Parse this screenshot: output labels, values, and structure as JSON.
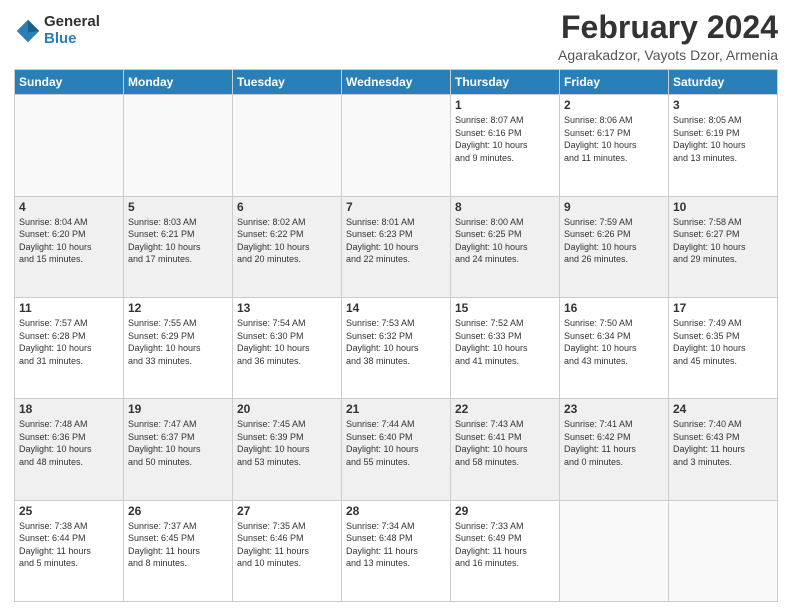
{
  "logo": {
    "general": "General",
    "blue": "Blue"
  },
  "header": {
    "title": "February 2024",
    "subtitle": "Agarakadzor, Vayots Dzor, Armenia"
  },
  "weekdays": [
    "Sunday",
    "Monday",
    "Tuesday",
    "Wednesday",
    "Thursday",
    "Friday",
    "Saturday"
  ],
  "weeks": [
    [
      {
        "day": "",
        "info": ""
      },
      {
        "day": "",
        "info": ""
      },
      {
        "day": "",
        "info": ""
      },
      {
        "day": "",
        "info": ""
      },
      {
        "day": "1",
        "info": "Sunrise: 8:07 AM\nSunset: 6:16 PM\nDaylight: 10 hours\nand 9 minutes."
      },
      {
        "day": "2",
        "info": "Sunrise: 8:06 AM\nSunset: 6:17 PM\nDaylight: 10 hours\nand 11 minutes."
      },
      {
        "day": "3",
        "info": "Sunrise: 8:05 AM\nSunset: 6:19 PM\nDaylight: 10 hours\nand 13 minutes."
      }
    ],
    [
      {
        "day": "4",
        "info": "Sunrise: 8:04 AM\nSunset: 6:20 PM\nDaylight: 10 hours\nand 15 minutes."
      },
      {
        "day": "5",
        "info": "Sunrise: 8:03 AM\nSunset: 6:21 PM\nDaylight: 10 hours\nand 17 minutes."
      },
      {
        "day": "6",
        "info": "Sunrise: 8:02 AM\nSunset: 6:22 PM\nDaylight: 10 hours\nand 20 minutes."
      },
      {
        "day": "7",
        "info": "Sunrise: 8:01 AM\nSunset: 6:23 PM\nDaylight: 10 hours\nand 22 minutes."
      },
      {
        "day": "8",
        "info": "Sunrise: 8:00 AM\nSunset: 6:25 PM\nDaylight: 10 hours\nand 24 minutes."
      },
      {
        "day": "9",
        "info": "Sunrise: 7:59 AM\nSunset: 6:26 PM\nDaylight: 10 hours\nand 26 minutes."
      },
      {
        "day": "10",
        "info": "Sunrise: 7:58 AM\nSunset: 6:27 PM\nDaylight: 10 hours\nand 29 minutes."
      }
    ],
    [
      {
        "day": "11",
        "info": "Sunrise: 7:57 AM\nSunset: 6:28 PM\nDaylight: 10 hours\nand 31 minutes."
      },
      {
        "day": "12",
        "info": "Sunrise: 7:55 AM\nSunset: 6:29 PM\nDaylight: 10 hours\nand 33 minutes."
      },
      {
        "day": "13",
        "info": "Sunrise: 7:54 AM\nSunset: 6:30 PM\nDaylight: 10 hours\nand 36 minutes."
      },
      {
        "day": "14",
        "info": "Sunrise: 7:53 AM\nSunset: 6:32 PM\nDaylight: 10 hours\nand 38 minutes."
      },
      {
        "day": "15",
        "info": "Sunrise: 7:52 AM\nSunset: 6:33 PM\nDaylight: 10 hours\nand 41 minutes."
      },
      {
        "day": "16",
        "info": "Sunrise: 7:50 AM\nSunset: 6:34 PM\nDaylight: 10 hours\nand 43 minutes."
      },
      {
        "day": "17",
        "info": "Sunrise: 7:49 AM\nSunset: 6:35 PM\nDaylight: 10 hours\nand 45 minutes."
      }
    ],
    [
      {
        "day": "18",
        "info": "Sunrise: 7:48 AM\nSunset: 6:36 PM\nDaylight: 10 hours\nand 48 minutes."
      },
      {
        "day": "19",
        "info": "Sunrise: 7:47 AM\nSunset: 6:37 PM\nDaylight: 10 hours\nand 50 minutes."
      },
      {
        "day": "20",
        "info": "Sunrise: 7:45 AM\nSunset: 6:39 PM\nDaylight: 10 hours\nand 53 minutes."
      },
      {
        "day": "21",
        "info": "Sunrise: 7:44 AM\nSunset: 6:40 PM\nDaylight: 10 hours\nand 55 minutes."
      },
      {
        "day": "22",
        "info": "Sunrise: 7:43 AM\nSunset: 6:41 PM\nDaylight: 10 hours\nand 58 minutes."
      },
      {
        "day": "23",
        "info": "Sunrise: 7:41 AM\nSunset: 6:42 PM\nDaylight: 11 hours\nand 0 minutes."
      },
      {
        "day": "24",
        "info": "Sunrise: 7:40 AM\nSunset: 6:43 PM\nDaylight: 11 hours\nand 3 minutes."
      }
    ],
    [
      {
        "day": "25",
        "info": "Sunrise: 7:38 AM\nSunset: 6:44 PM\nDaylight: 11 hours\nand 5 minutes."
      },
      {
        "day": "26",
        "info": "Sunrise: 7:37 AM\nSunset: 6:45 PM\nDaylight: 11 hours\nand 8 minutes."
      },
      {
        "day": "27",
        "info": "Sunrise: 7:35 AM\nSunset: 6:46 PM\nDaylight: 11 hours\nand 10 minutes."
      },
      {
        "day": "28",
        "info": "Sunrise: 7:34 AM\nSunset: 6:48 PM\nDaylight: 11 hours\nand 13 minutes."
      },
      {
        "day": "29",
        "info": "Sunrise: 7:33 AM\nSunset: 6:49 PM\nDaylight: 11 hours\nand 16 minutes."
      },
      {
        "day": "",
        "info": ""
      },
      {
        "day": "",
        "info": ""
      }
    ]
  ]
}
